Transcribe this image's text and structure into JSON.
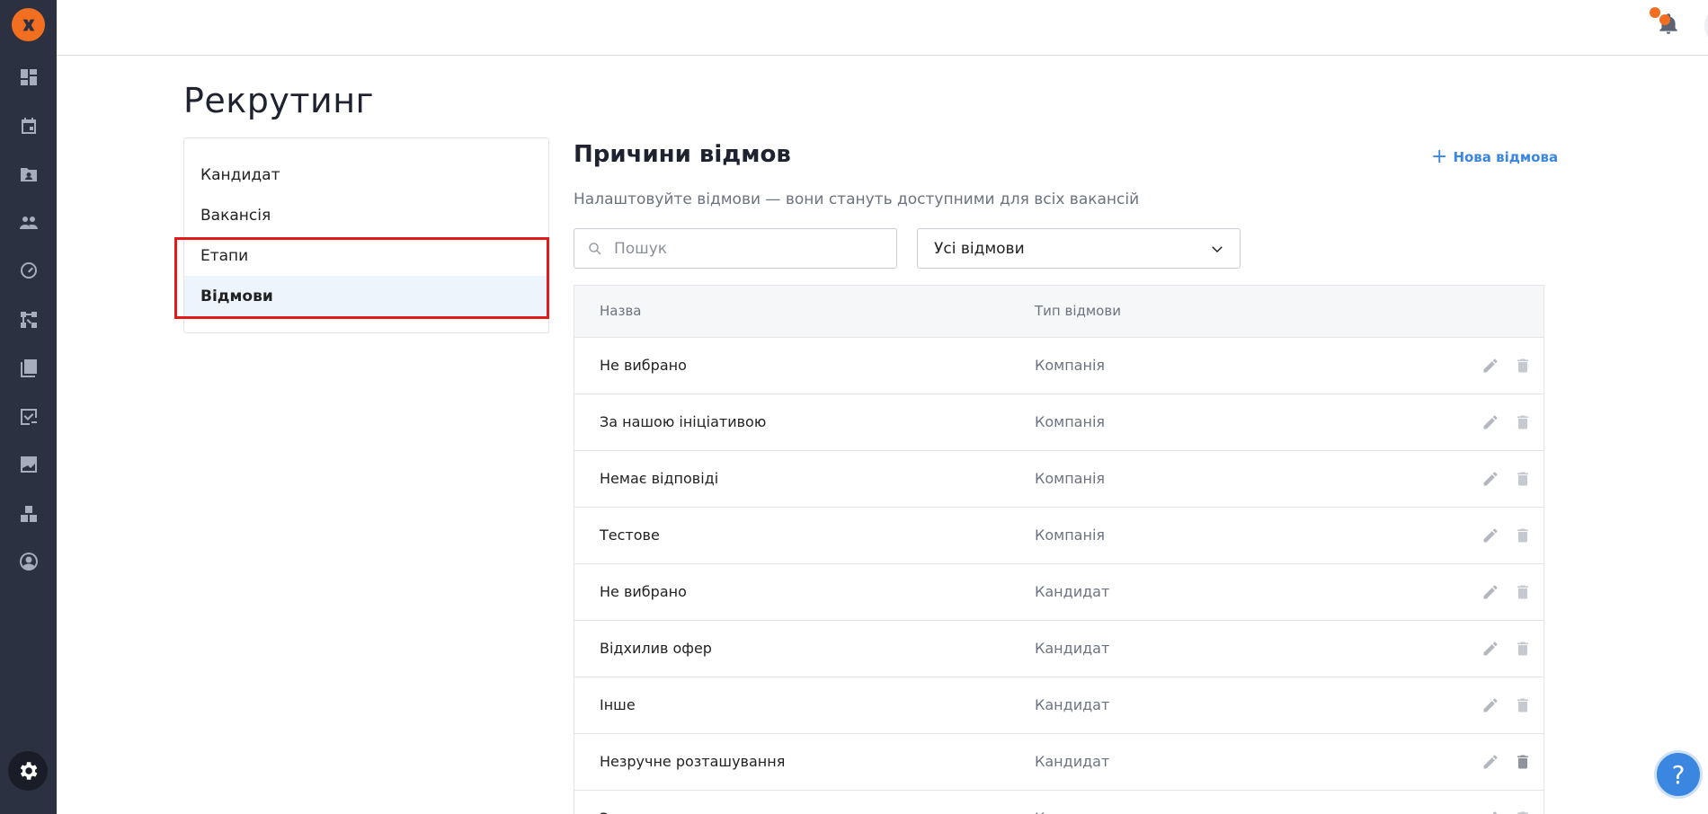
{
  "page": {
    "title": "Рекрутинг"
  },
  "menu": {
    "items": [
      {
        "label": "Кандидат"
      },
      {
        "label": "Вакансія"
      },
      {
        "label": "Етапи"
      },
      {
        "label": "Відмови"
      }
    ],
    "active_index": 3
  },
  "section": {
    "title": "Причини відмов",
    "subtitle": "Налаштовуйте відмови — вони стануть доступними для всіх вакансій",
    "add_label": "Нова відмова"
  },
  "search": {
    "placeholder": "Пошук",
    "value": ""
  },
  "filter": {
    "selected": "Усі відмови"
  },
  "table": {
    "headers": {
      "name": "Назва",
      "type": "Тип відмови"
    },
    "rows": [
      {
        "name": "Не вибрано",
        "type": "Компанія"
      },
      {
        "name": "За нашою ініціативою",
        "type": "Компанія"
      },
      {
        "name": "Немає відповіді",
        "type": "Компанія"
      },
      {
        "name": "Тестове",
        "type": "Компанія"
      },
      {
        "name": "Не вибрано",
        "type": "Кандидат"
      },
      {
        "name": "Відхилив офер",
        "type": "Кандидат"
      },
      {
        "name": "Інше",
        "type": "Кандидат"
      },
      {
        "name": "Незручне розташування",
        "type": "Кандидат"
      },
      {
        "name": "Зарплата",
        "type": "Кандидат"
      }
    ]
  },
  "help": {
    "label": "?"
  },
  "colors": {
    "sidebar": "#2c3142",
    "accent": "#f26f21",
    "link": "#3a86e0",
    "highlight": "#e31a1a"
  }
}
